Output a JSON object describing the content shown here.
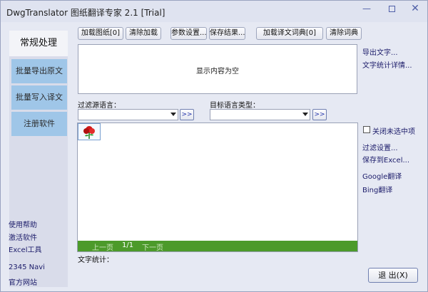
{
  "app": {
    "title": "DwgTranslator 图纸翻译专家 2.1 [Trial]",
    "window_controls": [
      "minimize",
      "maximize",
      "close"
    ]
  },
  "sidebar": {
    "tabs": [
      {
        "label": "常规处理",
        "active": true
      },
      {
        "label": "批量导出原文"
      },
      {
        "label": "批量写入译文"
      },
      {
        "label": "注册软件"
      }
    ],
    "links": [
      "使用帮助",
      "激活软件",
      "Excel工具"
    ],
    "footer": [
      "2345 Navi",
      "官方网站"
    ]
  },
  "toolbar": {
    "buttons": [
      "加载图纸[0]",
      "清除加载",
      "参数设置...",
      "保存结果...",
      "加载译文词典[0]",
      "清除词典"
    ]
  },
  "display": {
    "empty_text": "显示内容为空"
  },
  "filters": {
    "source_label": "过滤源语言：",
    "target_label": "目标语言类型：",
    "go_label": ">>"
  },
  "right_links": {
    "export_text": "导出文字...",
    "stats_detail": "文字统计详情...",
    "close_unselected": "关闭未选中项",
    "filter_settings": "过滤设置...",
    "save_excel": "保存到Excel...",
    "google": "Google翻译",
    "bing": "Bing翻译"
  },
  "pager": {
    "prev": "上一页",
    "page": "1/1",
    "next": "下一页"
  },
  "stats_label": "文字统计：",
  "exit_label": "退 出(X)",
  "colors": {
    "pager_green": "#4c9a2a",
    "active_tab_blue": "#9fc6e8"
  }
}
